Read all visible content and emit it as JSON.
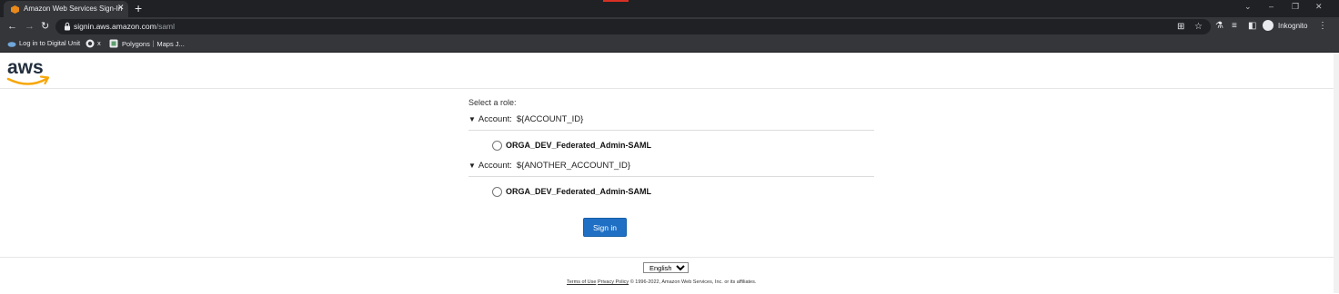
{
  "browser": {
    "tab_title": "Amazon Web Services Sign-In",
    "new_tab": "+",
    "close_tab": "✕",
    "url_host": "signin.aws.amazon.com",
    "url_path": "/saml",
    "profile_label": "Inkognito",
    "bookmarks": [
      "Log in to Digital Unit",
      "x",
      "Polygons｜Maps J..."
    ],
    "window_controls": [
      "⌄",
      "–",
      "❐",
      "✕"
    ]
  },
  "logo": {
    "text": "aws",
    "smile_color": "#f7a70b"
  },
  "form": {
    "prompt": "Select a role:",
    "accounts": [
      {
        "label": "Account:",
        "value": "${ACCOUNT_ID}",
        "roles": [
          "ORGA_DEV_Federated_Admin-SAML"
        ]
      },
      {
        "label": "Account:",
        "value": "${ANOTHER_ACCOUNT_ID}",
        "roles": [
          "ORGA_DEV_Federated_Admin-SAML"
        ]
      }
    ],
    "submit_label": "Sign in",
    "accent": "#1f6fc5"
  },
  "footer": {
    "language": "English",
    "terms": "Terms of Use",
    "privacy": "Privacy Policy",
    "copyright": "© 1996-2022, Amazon Web Services, Inc. or its affiliates."
  }
}
